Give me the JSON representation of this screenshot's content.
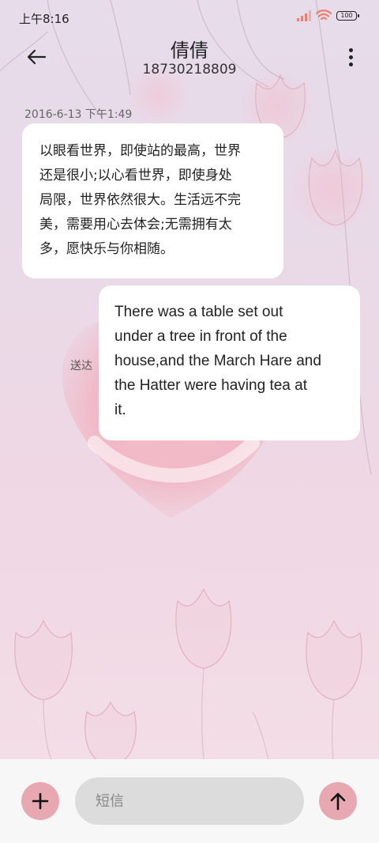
{
  "status_bar": {
    "time": "上午8:16",
    "battery": "100",
    "icons": [
      "signal-icon",
      "wifi-icon",
      "battery-icon"
    ]
  },
  "header": {
    "title": "倩倩",
    "subtitle": "18730218809",
    "icons": [
      "back-arrow-icon",
      "more-vertical-icon"
    ]
  },
  "conversation": {
    "timestamp": "2016-6-13 下午1:49",
    "messages": [
      {
        "direction": "incoming",
        "lines": [
          "以眼看世界，即使站的最高，世界",
          "还是很小;以心看世界，即使身处",
          "局限，世界依然很大。生活远不完",
          "美，需要用心去体会;无需拥有太",
          "多，愿快乐与你相随。"
        ]
      },
      {
        "direction": "outgoing",
        "lines": [
          "There was a table set out",
          "under a tree in front of the",
          "house,and the March Hare and",
          "the Hatter were having tea at",
          "it."
        ],
        "status": "送达"
      }
    ]
  },
  "composer": {
    "placeholder": "短信",
    "icons": [
      "plus-icon",
      "send-arrow-up-icon"
    ]
  },
  "colors": {
    "accent": "#e8a8b2",
    "bubble": "#ffffff",
    "input_bg": "#dcdcdc",
    "signal_color": "#e9806f"
  }
}
